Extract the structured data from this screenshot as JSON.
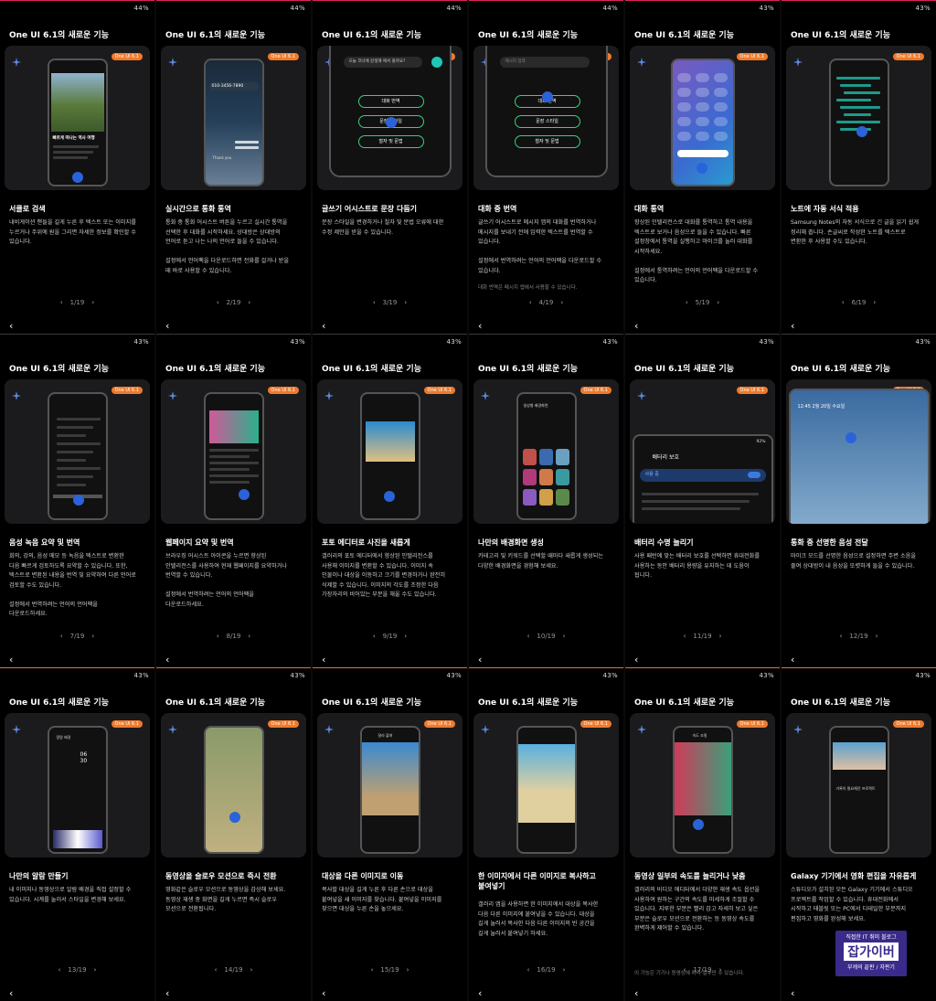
{
  "app_title": "One UI 6.1의 새로운 기능",
  "badge": "One UI 6.1",
  "status": [
    "44%",
    "44%",
    "44%",
    "44%",
    "43%",
    "43%",
    "43%",
    "43%",
    "43%",
    "43%",
    "43%",
    "43%",
    "43%",
    "43%",
    "43%",
    "43%",
    "43%",
    "43%"
  ],
  "pages": [
    {
      "title": "서클로 검색",
      "desc": "내비게이션 핸들을 길게 누른 후 텍스트 또는 이미지를\n누르거나 주위에 원을 그리면 자세한 정보를 확인할 수\n있습니다.",
      "pager": "1/19"
    },
    {
      "title": "실시간으로 통화 통역",
      "desc": "통화 중 통화 어시스트 버튼을 누르고 실시간 통역을\n선택한 후 대화를 시작하세요. 상대방은 상대방의\n언어로 듣고 나는 나의 언어로 들을 수 있습니다.\n\n설정에서 언어팩을 다운로드하면 전화를 걸거나 받을\n때 바로 사용할 수 있습니다.",
      "pager": "2/19"
    },
    {
      "title": "글쓰기 어시스트로 문장 다듬기",
      "desc": "문장 스타일을 변경하거나 철자 및 문법 오류에 대한\n수정 제안을 받을 수 있습니다.",
      "pager": "3/19"
    },
    {
      "title": "대화 중 번역",
      "desc": "글쓰기 어시스트로 메시지 앱의 대화를 번역하거나\n메시지를 보내기 전에 입력한 텍스트를 번역할 수\n있습니다.\n\n설정에서 번역하려는 언어의 언어팩을 다운로드할 수\n있습니다.",
      "note": "대화 번역은 메시지 앱에서 사용할 수 있습니다.",
      "pager": "4/19"
    },
    {
      "title": "대화 통역",
      "desc": "향상된 인텔리전스로 대화를 통역하고 통역 내용을\n텍스트로 보거나 음성으로 들을 수 있습니다. 빠른\n설정창에서 통역을 실행하고 마이크를 눌러 대화를\n시작하세요.\n\n설정에서 통역하려는 언어의 언어팩을 다운로드할 수\n있습니다.",
      "pager": "5/19"
    },
    {
      "title": "노트에 자동 서식 적용",
      "desc": "Samsung Notes의 자동 서식으로 긴 글을 읽기 쉽게\n정리해 줍니다. 손글씨로 작성한 노트를 텍스트로\n변환한 후 사용할 수도 있습니다.",
      "pager": "6/19"
    },
    {
      "title": "음성 녹음 요약 및 번역",
      "desc": "회의, 강의, 음성 메모 등 녹음을 텍스트로 변환한\n다음 빠르게 검토하도록 요약할 수 있습니다. 또한,\n텍스트로 변환된 내용을 번역 및 요약하여 다른 언어로\n검토할 수도 있습니다.\n\n설정에서 번역하려는 언어의 언어팩을\n다운로드하세요.",
      "pager": "7/19"
    },
    {
      "title": "웹페이지 요약 및 번역",
      "desc": "브라우징 어시스트 아이콘을 누르면 향상된\n인텔리전스를 사용하여 현재 웹페이지를 요약하거나\n번역할 수 있습니다.\n\n설정에서 번역하려는 언어의 언어팩을\n다운로드하세요.",
      "pager": "8/19"
    },
    {
      "title": "포토 에디터로 사진을 새롭게",
      "desc": "갤러리의 포토 에디터에서 향상된 인텔리전스를\n사용해 이미지를 변환할 수 있습니다. 이미지 속\n인물이나 대상을 이동하고 크기를 변경하거나 완전히\n삭제할 수 있습니다. 이미지의 각도를 조정한 다음\n가장자리의 비어있는 부분을 채울 수도 있습니다.",
      "pager": "9/19"
    },
    {
      "title": "나만의 배경화면 생성",
      "desc": "카테고리 및 키워드를 선택할 때마다 새롭게 생성되는\n다양한 배경화면을 경험해 보세요.",
      "pager": "10/19"
    },
    {
      "title": "배터리 수명 늘리기",
      "desc": "사용 패턴에 맞는 배터리 보호를 선택하면 휴대전화를\n사용하는 동안 배터리 용량을 유지하는 데 도움이\n됩니다.",
      "pager": "11/19"
    },
    {
      "title": "통화 중 선명한 음성 전달",
      "desc": "마이크 모드를 선명한 음성으로 설정하면 주변 소음을\n줄여 상대방이 내 음성을 또렷하게 들을 수 있습니다.",
      "pager": "12/19"
    },
    {
      "title": "나만의 알람 만들기",
      "desc": "내 이미지나 동영상으로 알람 배경을 직접 설정할 수\n있습니다. 시계를 눌러서 스타일을 변경해 보세요.",
      "pager": "13/19"
    },
    {
      "title": "동영상을 슬로우 모션으로 즉시 전환",
      "desc": "영화같은 슬로우 모션으로 동영상을 감상해 보세요.\n동영상 재생 중 화면을 길게 누르면 즉시 슬로우\n모션으로 전환됩니다.",
      "pager": "14/19"
    },
    {
      "title": "대상을 다른 이미지로 이동",
      "desc": "복사할 대상을 길게 누른 후 다른 손으로 대상을\n붙여넣을 새 이미지를 찾습니다. 붙여넣을 이미지를\n찾으면 대상을 누른 손을 놓으세요.",
      "pager": "15/19"
    },
    {
      "title": "한 이미지에서 다른 이미지로 복사하고\n붙여넣기",
      "desc": "갤러리 앱을 사용하면 한 이미지에서 대상을 복사한\n다음 다른 이미지에 붙여넣을 수 있습니다. 대상을\n길게 눌러서 복사한 다음 다른 이미지의 빈 공간을\n길게 눌러서 붙여넣기 하세요.",
      "pager": "16/19"
    },
    {
      "title": "동영상 일부의 속도를 늘리거나 낮춤",
      "desc": "갤러리의 비디오 에디터에서 다양한 재생 속도 옵션을\n사용하여 원하는 구간의 속도를 미세하게 조절할 수\n있습니다. 지루한 부분은 빨리 감고 자세히 보고 싶은\n부분은 슬로우 모션으로 전환하는 등 동영상 속도를\n완벽하게 제어할 수 있습니다.",
      "note": "이 기능은 기기나 동영상에 따라 일부만 수 있습니다.",
      "pager": "17/19"
    },
    {
      "title": "Galaxy 기기에서 영화 편집을 자유롭게",
      "desc": "스튜디오가 설치된 모든 Galaxy 기기에서 스튜디오\n프로젝트를 작업할 수 있습니다. 휴대전화에서\n시작하고 태블릿 또는 PC에서 디테일한 부분까지\n편집하고 영화를 완성해 보세요.",
      "pager": ""
    }
  ],
  "screens": {
    "p1_caption": "빠르게 떠나는 역사 여행",
    "p2_number": "010-3456-7890",
    "p2_thanks": "Thank you",
    "p3_input": "오늘 코너에 갈생해 에서 볼까요?",
    "p3_buttons": [
      "대화 번역",
      "문장 스타일",
      "철자 및 문법"
    ],
    "p4_input": "메시지 입력",
    "p4_buttons": [
      "대화 번역",
      "문장 스타일",
      "철자 및 문법"
    ],
    "p10_header": "생성형 배경화면",
    "p11_header": "배터리 보호",
    "p11_toggle_label": "사용 중",
    "p11_battery_pct": "92%",
    "p12_datetime": "12:45 2월 20일 수요일",
    "p13_header": "알람 배경",
    "p13_time": "06\n30",
    "p15_header": "잘라 붙여",
    "p17_header": "속도 조절",
    "p18_text": "기록이 필요해진 프로젝트"
  },
  "watermark": {
    "line1": "직접한 IT 취미 블로그",
    "big": "잡가이버",
    "line2": "부캐의 끝판 / 자판기"
  }
}
